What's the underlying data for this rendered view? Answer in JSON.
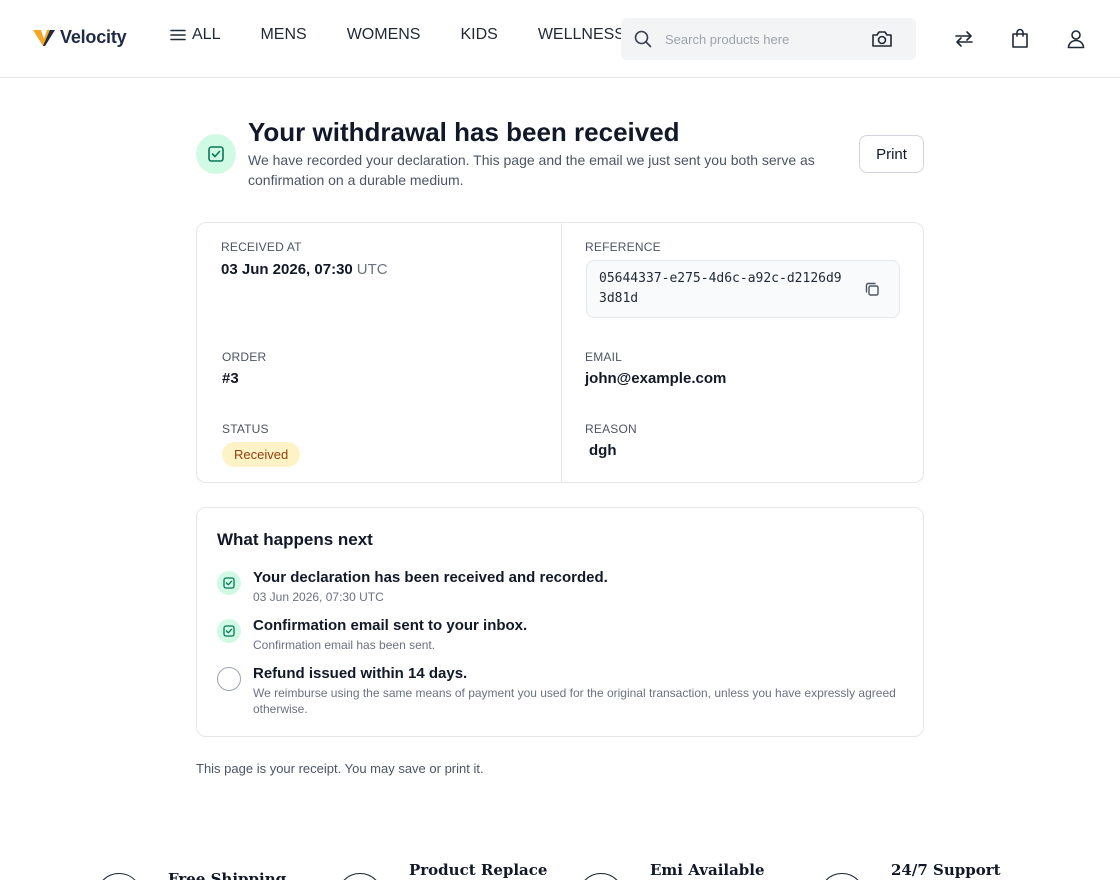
{
  "header": {
    "brand": "Velocity",
    "nav": [
      {
        "label": "ALL",
        "icon": "menu-icon"
      },
      {
        "label": "MENS"
      },
      {
        "label": "WOMENS"
      },
      {
        "label": "KIDS"
      },
      {
        "label": "WELLNESS"
      }
    ],
    "search": {
      "placeholder": "Search products here",
      "value": ""
    },
    "icons": [
      "search-icon",
      "camera-icon",
      "compare-icon",
      "bag-icon",
      "user-icon"
    ]
  },
  "confirmation": {
    "title": "Your withdrawal has been received",
    "subtitle": "We have recorded your declaration. This page and the email we just sent you both serve as confirmation on a durable medium.",
    "print_label": "Print"
  },
  "details": {
    "received_at_label": "RECEIVED AT",
    "received_at_value": "03 Jun 2026, 07:30",
    "received_at_tz": "UTC",
    "reference_label": "REFERENCE",
    "reference_value": "05644337-e275-4d6c-a92c-d2126d93d81d",
    "order_label": "ORDER",
    "order_value": "#3",
    "email_label": "EMAIL",
    "email_value": "john@example.com",
    "status_label": "STATUS",
    "status_value": "Received",
    "reason_label": "REASON",
    "reason_value": "dgh"
  },
  "next_steps": {
    "title": "What happens next",
    "steps": [
      {
        "title": "Your declaration has been received and recorded.",
        "desc": "03 Jun 2026, 07:30 UTC",
        "state": "done"
      },
      {
        "title": "Confirmation email sent to your inbox.",
        "desc": "Confirmation email has been sent.",
        "state": "done"
      },
      {
        "title": "Refund issued within 14 days.",
        "desc": "We reimburse using the same means of payment you used for the original transaction, unless you have expressly agreed otherwise.",
        "state": "pending"
      }
    ]
  },
  "receipt_note": "This page is your receipt. You may save or print it.",
  "features": [
    {
      "label": "Free Shipping"
    },
    {
      "label": "Product Replace"
    },
    {
      "label": "Emi Available"
    },
    {
      "label": "24/7 Support"
    }
  ],
  "colors": {
    "accent_green_bg": "#d1fae5",
    "accent_green": "#059669",
    "status_bg": "#fef3c7",
    "status_text": "#92400e",
    "logo_orange": "#f5a623",
    "logo_navy": "#1f2a44"
  }
}
